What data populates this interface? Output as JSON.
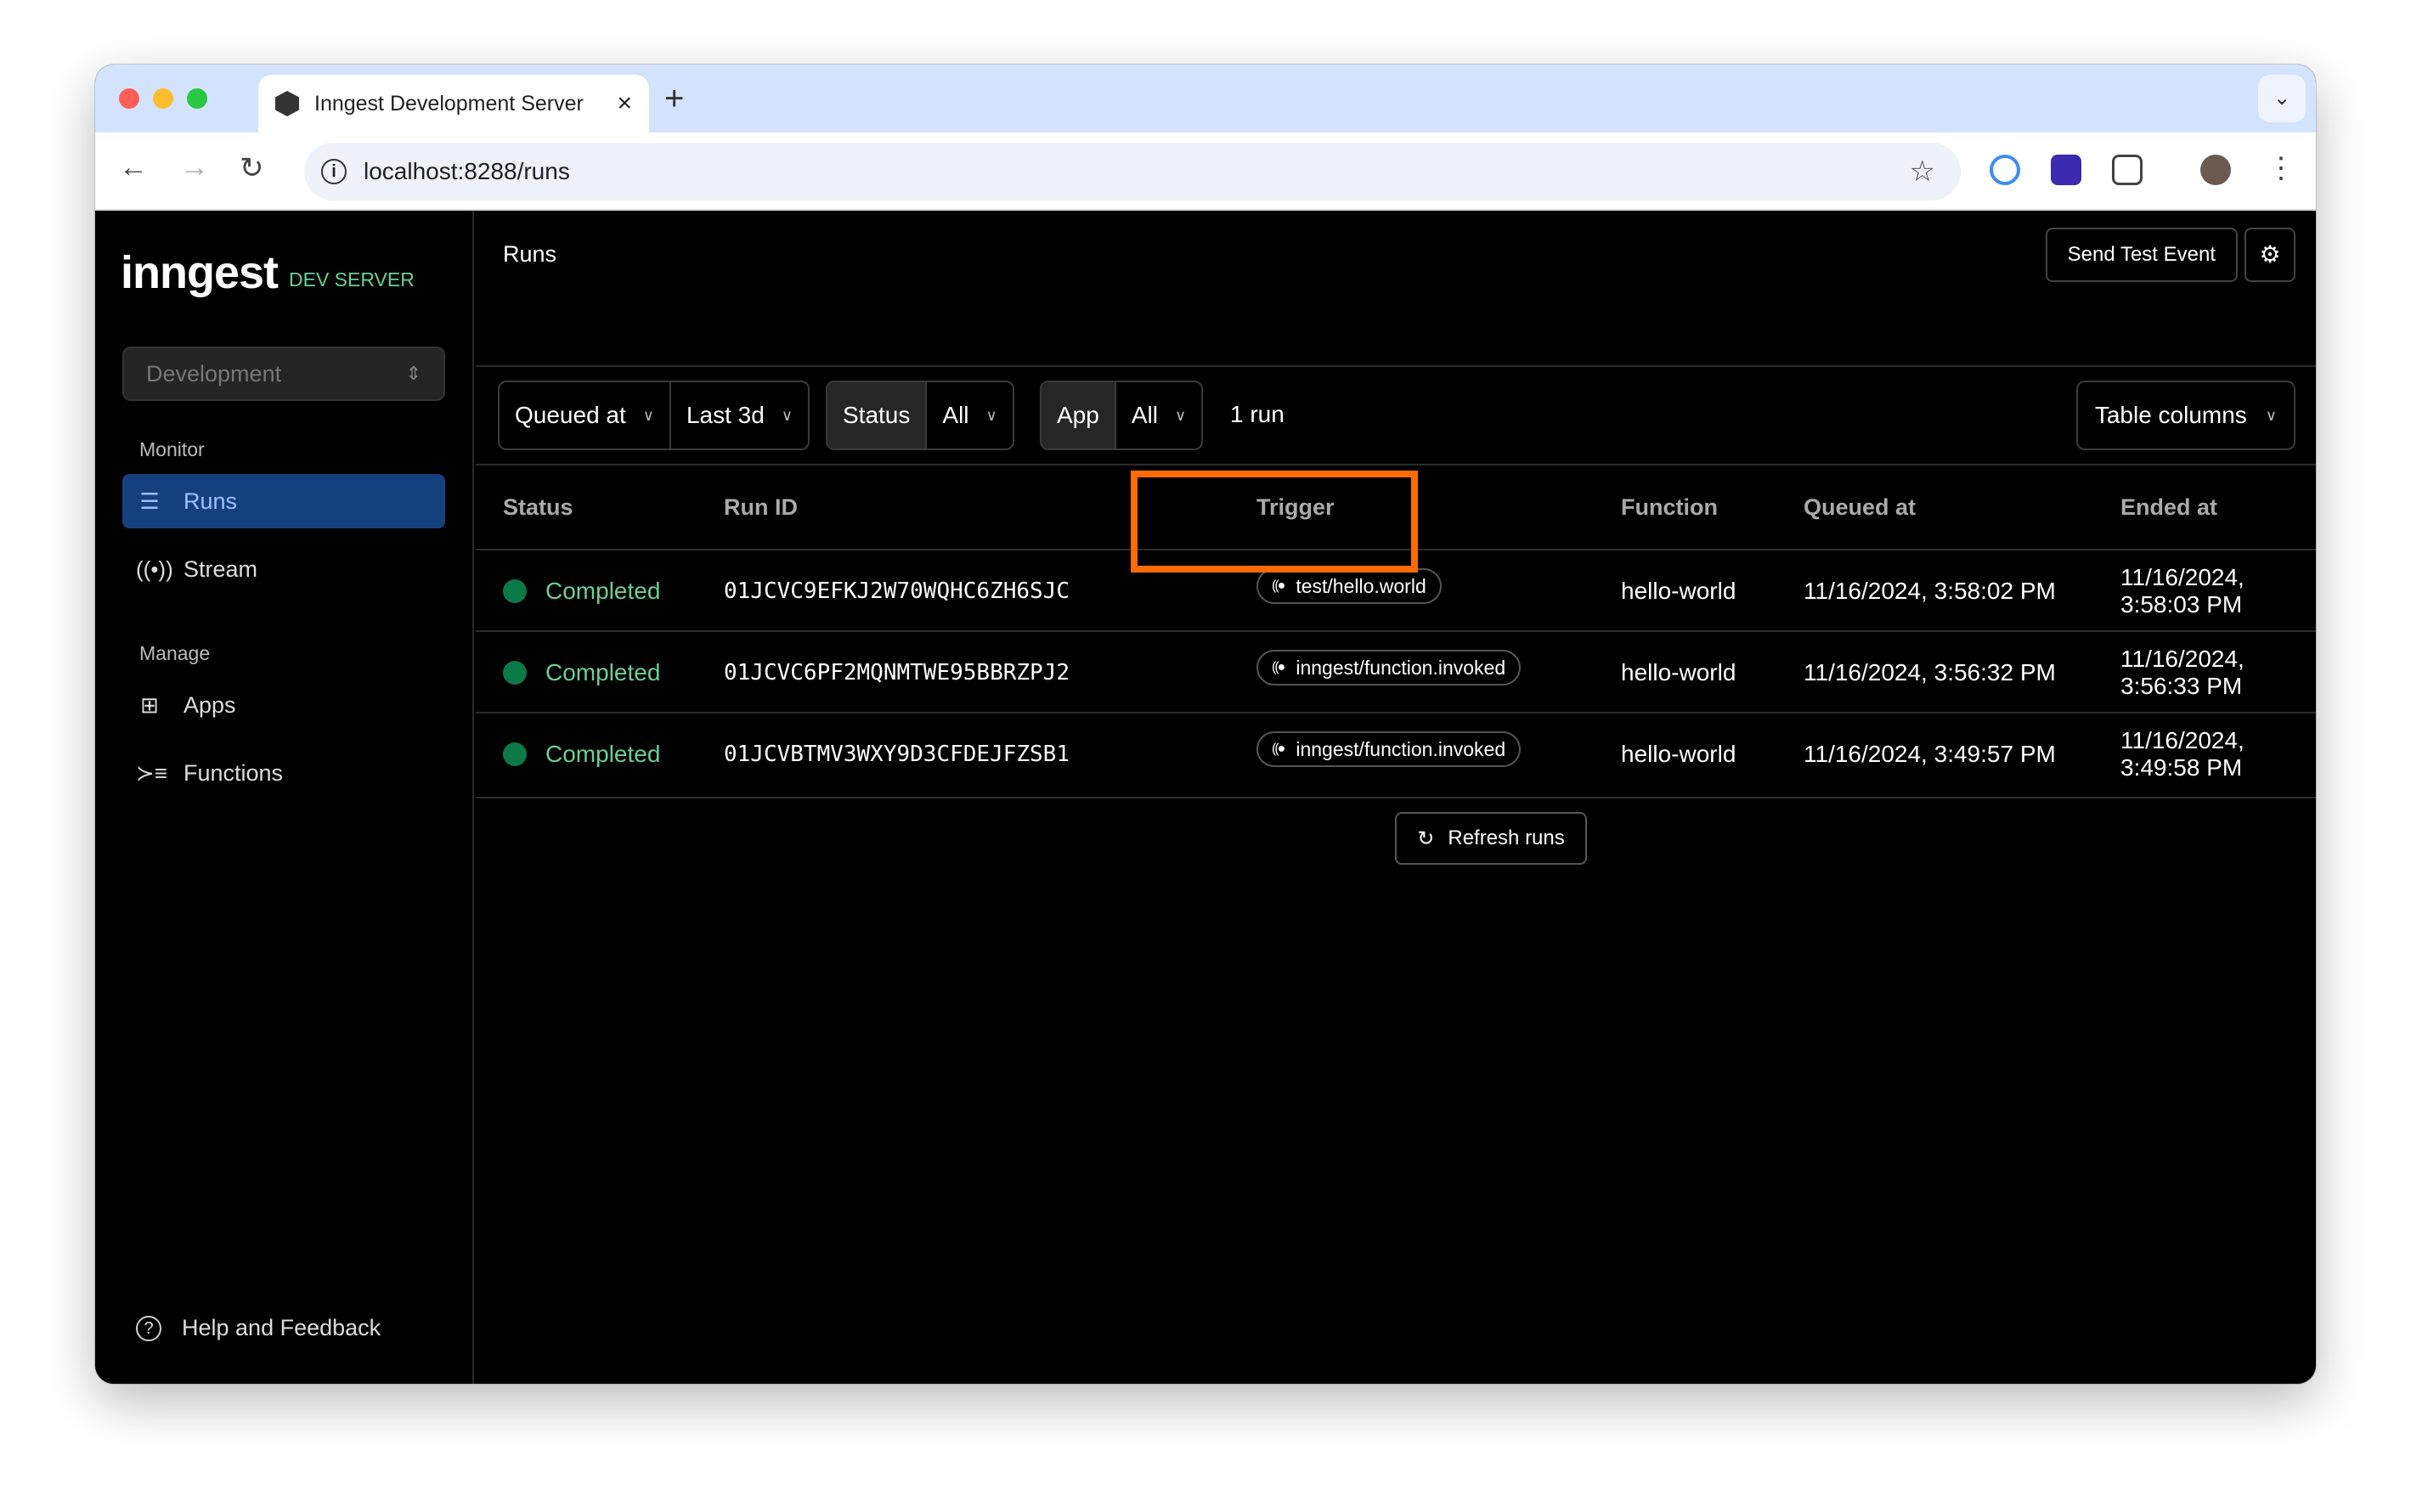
{
  "browser": {
    "tab_title": "Inngest Development Server",
    "url": "localhost:8288/runs"
  },
  "sidebar": {
    "logo": "inngest",
    "badge": "DEV SERVER",
    "environment": "Development",
    "monitor_label": "Monitor",
    "manage_label": "Manage",
    "items": [
      {
        "label": "Runs",
        "icon": "runs-list-icon"
      },
      {
        "label": "Stream",
        "icon": "broadcast-icon"
      },
      {
        "label": "Apps",
        "icon": "apps-grid-icon"
      },
      {
        "label": "Functions",
        "icon": "functions-list-icon"
      }
    ],
    "help": "Help and Feedback"
  },
  "header": {
    "title": "Runs",
    "send_test_event": "Send Test Event"
  },
  "filters": {
    "time_field": "Queued at",
    "time_range": "Last 3d",
    "status_label": "Status",
    "status_value": "All",
    "app_label": "App",
    "app_value": "All",
    "count": "1 run",
    "table_columns": "Table columns"
  },
  "table": {
    "columns": [
      "Status",
      "Run ID",
      "Trigger",
      "Function",
      "Queued at",
      "Ended at"
    ],
    "rows": [
      {
        "status": "Completed",
        "run_id": "01JCVC9EFKJ2W70WQHC6ZH6SJC",
        "trigger": "test/hello.world",
        "function": "hello-world",
        "queued_at": "11/16/2024, 3:58:02 PM",
        "ended_at": "11/16/2024, 3:58:03 PM"
      },
      {
        "status": "Completed",
        "run_id": "01JCVC6PF2MQNMTWE95BBRZPJ2",
        "trigger": "inngest/function.invoked",
        "function": "hello-world",
        "queued_at": "11/16/2024, 3:56:32 PM",
        "ended_at": "11/16/2024, 3:56:33 PM"
      },
      {
        "status": "Completed",
        "run_id": "01JCVBTMV3WXY9D3CFDEJFZSB1",
        "trigger": "inngest/function.invoked",
        "function": "hello-world",
        "queued_at": "11/16/2024, 3:49:57 PM",
        "ended_at": "11/16/2024, 3:49:58 PM"
      }
    ]
  },
  "refresh": "Refresh runs",
  "colors": {
    "accent": "#16417f",
    "completed": "#0b7a48",
    "highlight": "#ff6b00"
  }
}
